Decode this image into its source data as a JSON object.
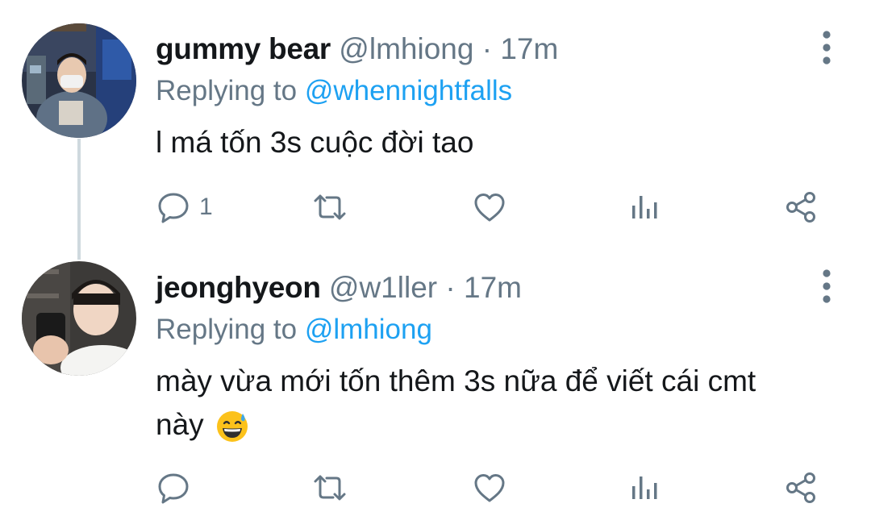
{
  "tweets": [
    {
      "display_name": "gummy bear",
      "handle": "@lmhiong",
      "separator": "·",
      "time": "17m",
      "replying_prefix": "Replying to",
      "replying_to": "@whennightfalls",
      "body_lines": [
        "l má tốn 3s cuộc đời tao"
      ],
      "reply_count": "1"
    },
    {
      "display_name": "jeonghyeon",
      "handle": "@w1ller",
      "separator": "·",
      "time": "17m",
      "replying_prefix": "Replying to",
      "replying_to": "@lmhiong",
      "body_lines": [
        "mày vừa mới tốn thêm 3s nữa để viết cái cmt",
        "này"
      ],
      "emoji": "grinning-face-with-sweat",
      "reply_count": ""
    }
  ],
  "icons": {
    "more": "more-vertical-icon",
    "reply": "reply-icon",
    "retweet": "retweet-icon",
    "like": "heart-icon",
    "stats": "analytics-icon",
    "share": "share-icon"
  },
  "colors": {
    "text": "#14171a",
    "secondary": "#657786",
    "link": "#1da1f2",
    "thread_line": "#cfd9de",
    "background": "#ffffff"
  }
}
